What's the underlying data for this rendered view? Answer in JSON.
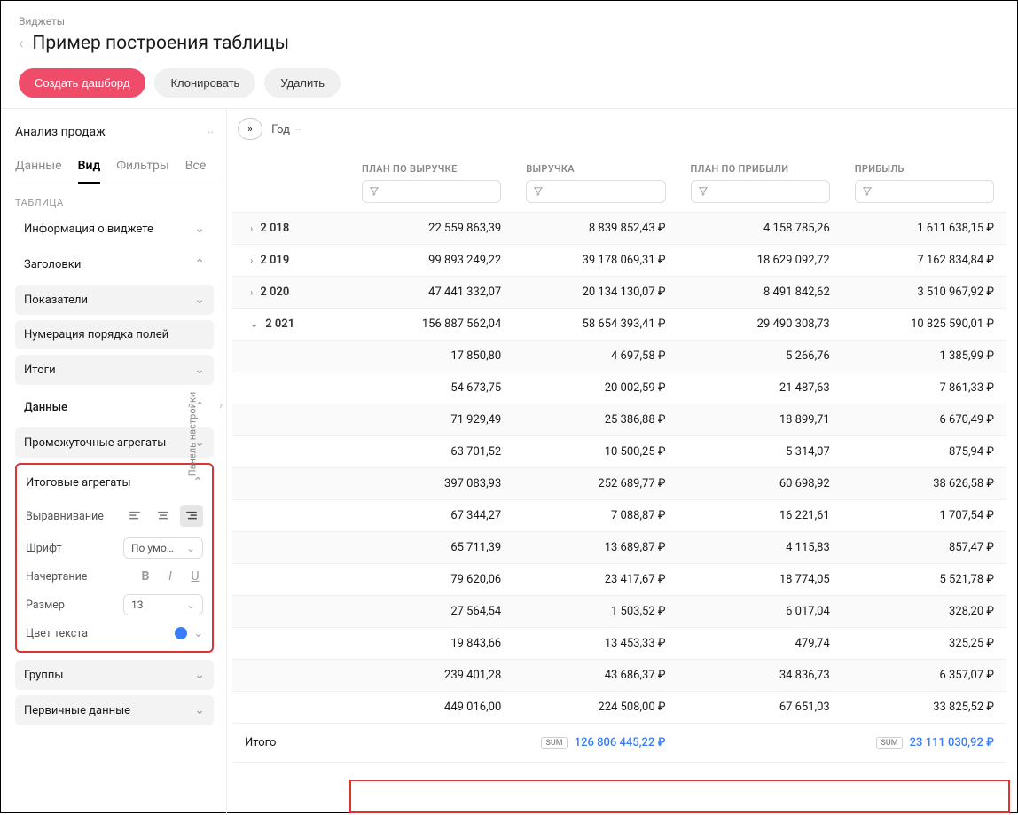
{
  "breadcrumb": "Виджеты",
  "page_title": "Пример построения таблицы",
  "actions": {
    "create": "Создать дашборд",
    "clone": "Клонировать",
    "delete": "Удалить"
  },
  "source_name": "Анализ продаж",
  "tabs": {
    "data": "Данные",
    "view": "Вид",
    "filters": "Фильтры",
    "all": "Все"
  },
  "panel_toggle_label": "Панель настройки",
  "section_table": "ТАБЛИЦА",
  "acc_widget_info": "Информация о виджете",
  "acc_headers": "Заголовки",
  "acc_indicators": "Показатели",
  "acc_numbering": "Нумерация порядка полей",
  "acc_totals": "Итоги",
  "section_data": "Данные",
  "acc_intermediate": "Промежуточные агрегаты",
  "acc_final": "Итоговые агрегаты",
  "form": {
    "align_label": "Выравнивание",
    "font_label": "Шрифт",
    "font_value": "По умо…",
    "style_label": "Начертание",
    "size_label": "Размер",
    "size_value": "13",
    "color_label": "Цвет текста"
  },
  "acc_groups": "Группы",
  "acc_primary": "Первичные данные",
  "chip_label": "Год",
  "columns": {
    "c1": "ПЛАН ПО ВЫРУЧКЕ",
    "c2": "ВЫРУЧКА",
    "c3": "ПЛАН ПО ПРИБЫЛИ",
    "c4": "ПРИБЫЛЬ"
  },
  "years": [
    {
      "label": "2 018",
      "expanded": false,
      "plan_rev": "22 559 863,39",
      "rev": "8 839 852,43 ₽",
      "plan_prof": "4 158 785,26",
      "prof": "1 611 638,15 ₽"
    },
    {
      "label": "2 019",
      "expanded": false,
      "plan_rev": "99 893 249,22",
      "rev": "39 178 069,31 ₽",
      "plan_prof": "18 629 092,72",
      "prof": "7 162 834,84 ₽"
    },
    {
      "label": "2 020",
      "expanded": false,
      "plan_rev": "47 441 332,07",
      "rev": "20 134 130,07 ₽",
      "plan_prof": "8 491 842,62",
      "prof": "3 510 967,92 ₽"
    },
    {
      "label": "2 021",
      "expanded": true,
      "plan_rev": "156 887 562,04",
      "rev": "58 654 393,41 ₽",
      "plan_prof": "29 490 308,73",
      "prof": "10 825 590,01 ₽"
    }
  ],
  "rows": [
    {
      "plan_rev": "17 850,80",
      "rev": "4 697,58 ₽",
      "plan_prof": "5 266,76",
      "prof": "1 385,99 ₽"
    },
    {
      "plan_rev": "54 673,75",
      "rev": "20 002,59 ₽",
      "plan_prof": "21 487,63",
      "prof": "7 861,33 ₽"
    },
    {
      "plan_rev": "71 929,49",
      "rev": "25 386,88 ₽",
      "plan_prof": "18 899,71",
      "prof": "6 670,49 ₽"
    },
    {
      "plan_rev": "63 701,52",
      "rev": "10 500,25 ₽",
      "plan_prof": "5 314,07",
      "prof": "875,94 ₽"
    },
    {
      "plan_rev": "397 083,93",
      "rev": "252 689,77 ₽",
      "plan_prof": "60 698,92",
      "prof": "38 626,58 ₽"
    },
    {
      "plan_rev": "67 344,27",
      "rev": "7 088,87 ₽",
      "plan_prof": "16 221,61",
      "prof": "1 707,54 ₽"
    },
    {
      "plan_rev": "65 711,39",
      "rev": "13 689,87 ₽",
      "plan_prof": "4 115,83",
      "prof": "857,47 ₽"
    },
    {
      "plan_rev": "79 620,06",
      "rev": "23 417,67 ₽",
      "plan_prof": "18 774,05",
      "prof": "5 521,78 ₽"
    },
    {
      "plan_rev": "27 564,54",
      "rev": "1 503,52 ₽",
      "plan_prof": "6 017,04",
      "prof": "328,20 ₽"
    },
    {
      "plan_rev": "19 843,66",
      "rev": "13 453,33 ₽",
      "plan_prof": "479,74",
      "prof": "325,25 ₽"
    },
    {
      "plan_rev": "239 401,28",
      "rev": "43 686,37 ₽",
      "plan_prof": "34 836,73",
      "prof": "6 357,07 ₽"
    },
    {
      "plan_rev": "449 016,00",
      "rev": "224 508,00 ₽",
      "plan_prof": "67 651,03",
      "prof": "33 825,52 ₽"
    }
  ],
  "footer": {
    "label": "Итого",
    "sum_badge": "SUM",
    "rev_total": "126 806 445,22 ₽",
    "prof_total": "23 111 030,92 ₽"
  }
}
